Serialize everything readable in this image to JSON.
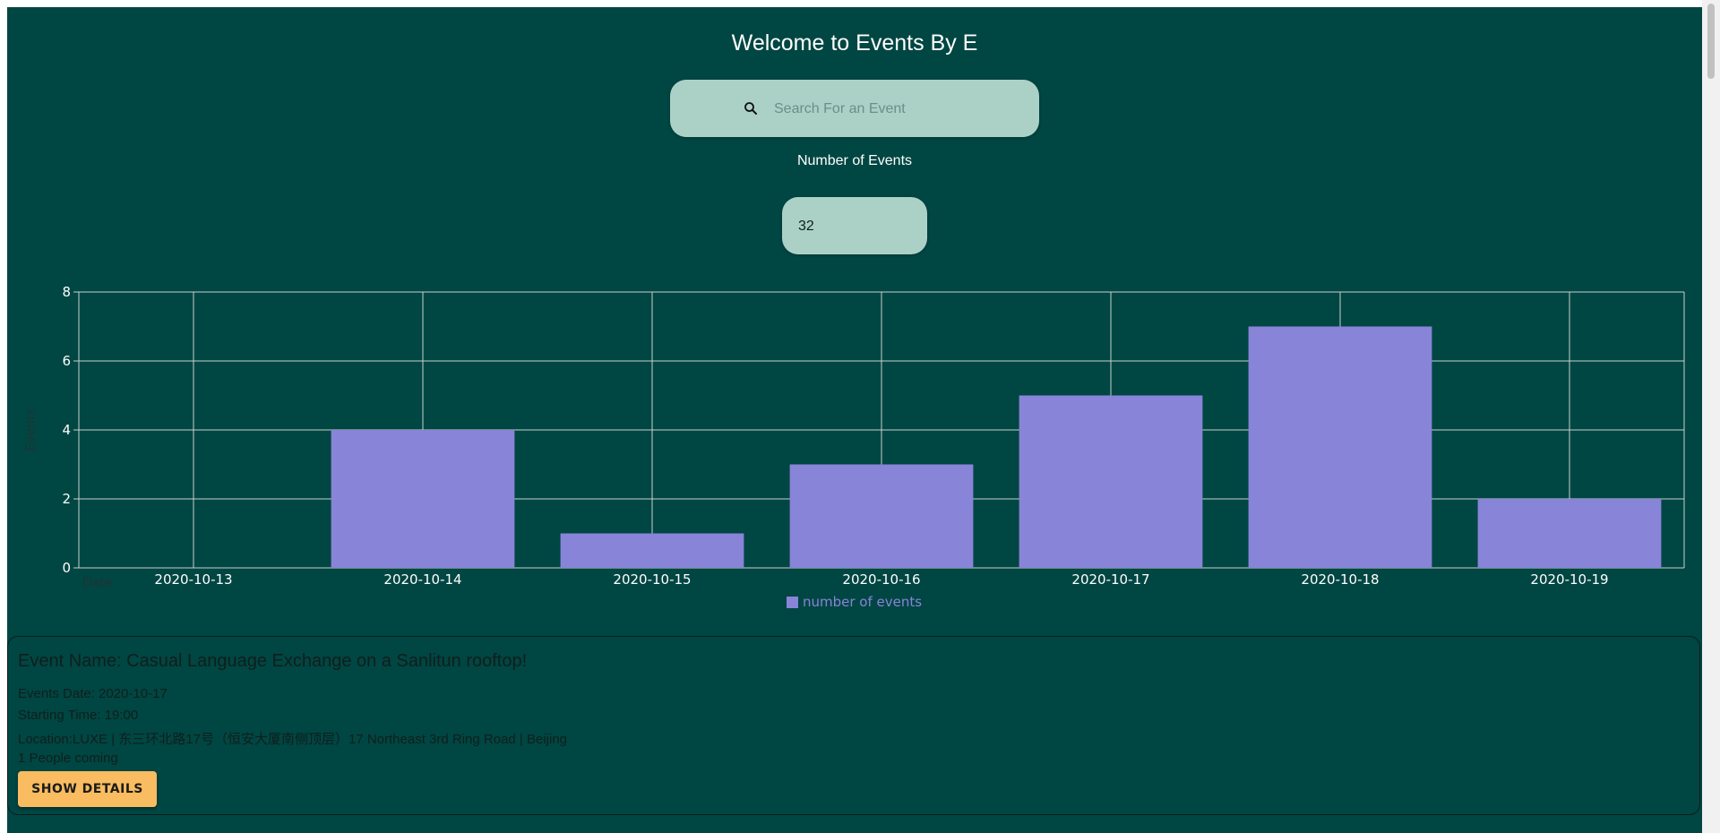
{
  "page": {
    "title": "Welcome to Events By E"
  },
  "search": {
    "placeholder": "Search For an Event",
    "value": ""
  },
  "count": {
    "label": "Number of Events",
    "value": "32"
  },
  "chart_data": {
    "type": "bar",
    "categories": [
      "2020-10-13",
      "2020-10-14",
      "2020-10-15",
      "2020-10-16",
      "2020-10-17",
      "2020-10-18",
      "2020-10-19"
    ],
    "series": [
      {
        "name": "number of events",
        "values": [
          0,
          4,
          1,
          3,
          5,
          7,
          2
        ],
        "color": "#8884d8"
      }
    ],
    "xlabel": "Date",
    "ylabel": "Events",
    "ylim": [
      0,
      8
    ],
    "yticks": [
      "0",
      "2",
      "4",
      "6",
      "8"
    ],
    "grid": true,
    "legend": "bottom-center"
  },
  "event": {
    "name": "Event Name: Casual Language Exchange on a Sanlitun rooftop!",
    "date": "Events Date: 2020-10-17",
    "time": "Starting Time: 19:00",
    "location": "Location:LUXE | 东三环北路17号（恒安大厦南侧顶层）17 Northeast 3rd Ring Road | Beijing",
    "attendees": "1 People coming",
    "button_label": "SHOW DETAILS"
  },
  "colors": {
    "background": "#004643",
    "input": "#abd1c6",
    "accent": "#f9bc60",
    "bar": "#8884d8"
  }
}
